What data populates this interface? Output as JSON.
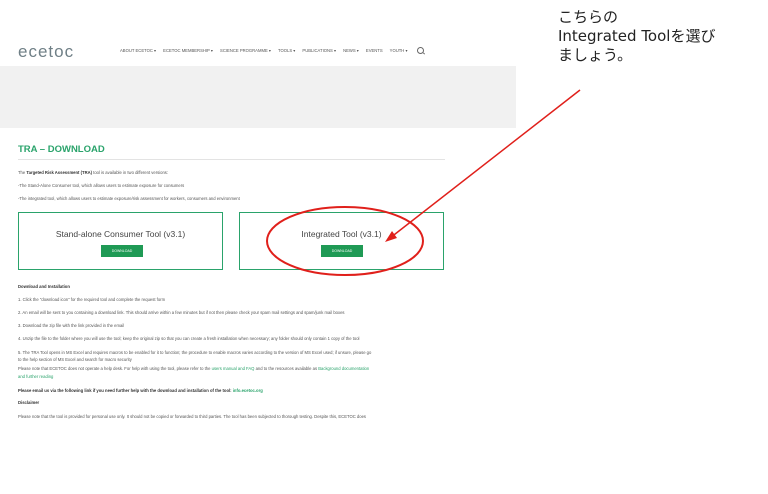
{
  "header": {
    "logo": "ecetoc",
    "nav": [
      "ABOUT ECETOC ▾",
      "ECETOC MEMBERSHIP ▾",
      "SCIENCE PROGRAMME ▾",
      "TOOLS ▾",
      "PUBLICATIONS ▾",
      "NEWS ▾",
      "EVENTS",
      "YOUTH ▾"
    ]
  },
  "content": {
    "title": "TRA – DOWNLOAD",
    "intro_prefix": "The ",
    "intro_bold": "Targeted Risk Assessment (TRA)",
    "intro_suffix": " tool is available in two different versions:",
    "bullet1": "-The Stand-Alone Consumer tool, which allows users to estimate exposure for consumers",
    "bullet2": "-The integrated tool, which allows users to estimate exposure/risk assessment for workers, consumers and environment",
    "box1_title": "Stand-alone Consumer Tool (v3.1)",
    "box2_title": "Integrated Tool (v3.1)",
    "download_label": "DOWNLOAD",
    "install_heading": "Download and Installation",
    "step1": "1. Click the \"download icon\" for the required tool and complete the request form",
    "step2": "2. An email will be sent to you containing a download link. This should arrive within a few minutes but if not then please check your spam mail settings and spam/junk mail boxes",
    "step3": "3. Download the zip file with the link provided in the email",
    "step4": "4. Unzip the file to the folder where you will use the tool; keep the original zip so that you can create a fresh installation when necessary; any folder should only contain 1 copy of the tool",
    "step5a": "5. The TRA Tool opens in MS Excel and requires macros to be enabled for it to function; the procedure to enable macros varies according to the version of MS Excel used; if unsure, please go",
    "step5b": "to the help section of MS Excel and search for macro security",
    "note_a": "Please note that ECETOC does not operate a help desk. For help with using the tool, please refer to the ",
    "note_link1": "users manual and FAQ",
    "note_mid": " and to the resources available as ",
    "note_link2": "Background documentation",
    "note_b": "and further reading",
    "email_text": "Please email us via the following link if you need further help with the download and installation of the tool: ",
    "email_link": "info.ecetoc.org",
    "disclaimer_heading": "Disclaimer",
    "disclaimer_text": "Please note that the tool is provided for personal use only. It should not be copied or forwarded to third parties. The tool has been subjected to thorough testing. Despite this, ECETOC does"
  },
  "annotation": {
    "text": "こちらの\nIntegrated Toolを選び\nましょう。",
    "color": "#e0201b"
  }
}
